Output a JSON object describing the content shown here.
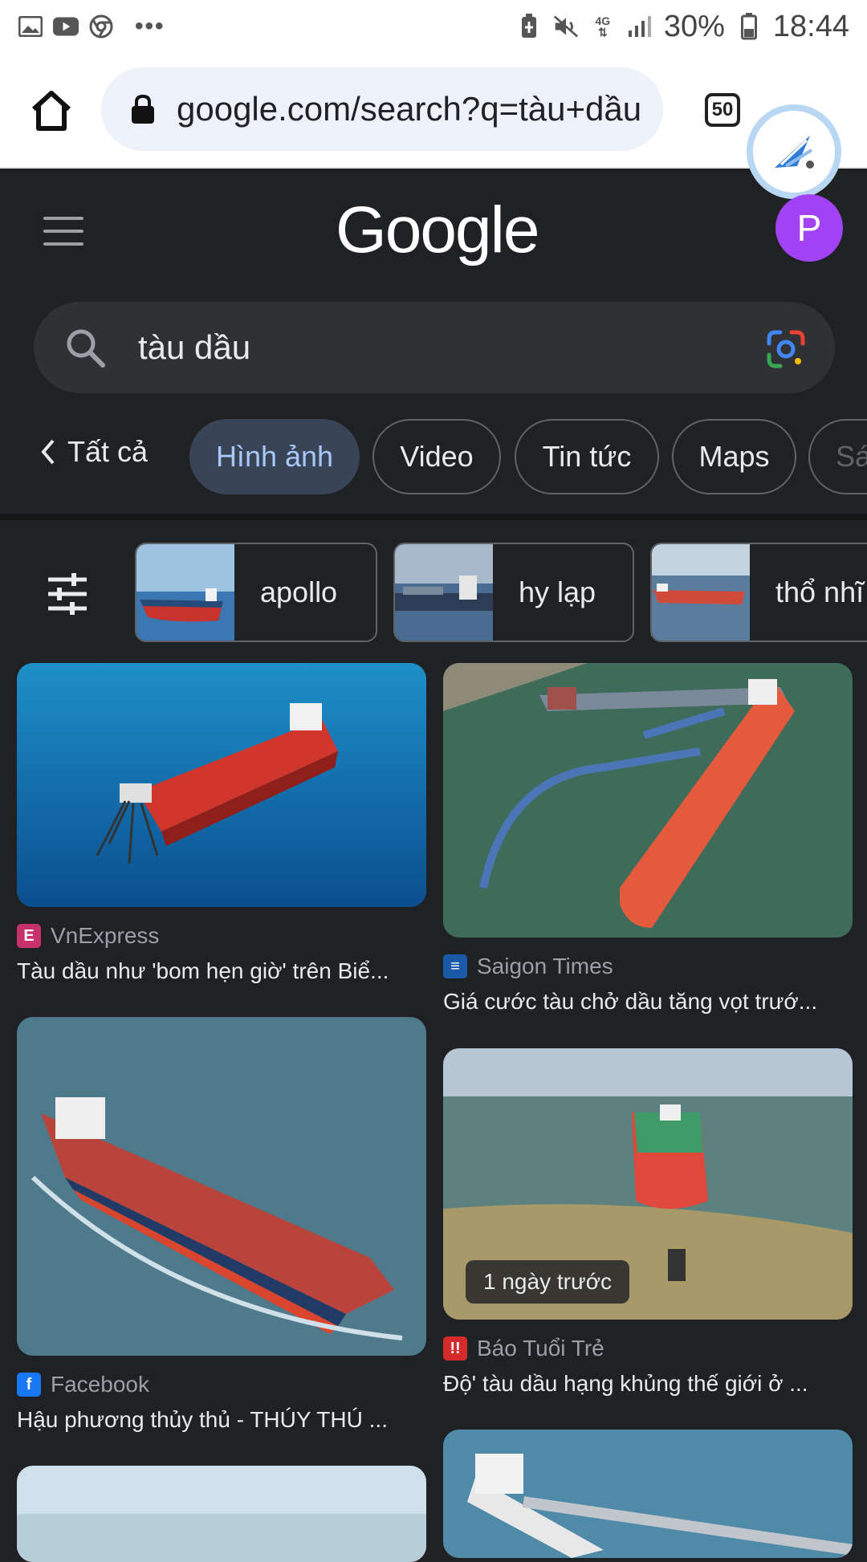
{
  "status_bar": {
    "battery": "30%",
    "time": "18:44",
    "network": "4G",
    "icons": [
      "image-icon",
      "youtube-icon",
      "chrome-icon",
      "more-dots-icon",
      "battery-saver-icon",
      "mute-icon",
      "signal-icon",
      "battery-icon"
    ]
  },
  "browser": {
    "url": "google.com/search?q=tàu+dầu",
    "tab_count": "50"
  },
  "header": {
    "logo": "Google",
    "avatar_letter": "P"
  },
  "search": {
    "query": "tàu dầu"
  },
  "tabs": {
    "back_label": "Tất cả",
    "items": [
      {
        "label": "Hình ảnh",
        "active": true
      },
      {
        "label": "Video",
        "active": false
      },
      {
        "label": "Tin tức",
        "active": false
      },
      {
        "label": "Maps",
        "active": false
      },
      {
        "label": "Sá",
        "active": false
      }
    ]
  },
  "suggestions": [
    {
      "label": "apollo"
    },
    {
      "label": "hy lạp"
    },
    {
      "label": "thổ nhĩ"
    }
  ],
  "results": [
    {
      "source": "VnExpress",
      "title": "Tàu dầu như 'bom hẹn giờ' trên Biể..."
    },
    {
      "source": "Saigon Times",
      "title": "Giá cước tàu chở dầu tăng vọt trướ..."
    },
    {
      "source": "Facebook",
      "title": "Hậu phương thủy thủ - THÚY THÚ ..."
    },
    {
      "source": "Báo Tuổi Trẻ",
      "title": "Độ' tàu dầu hạng khủng thế giới ở ...",
      "badge": "1 ngày trước"
    }
  ],
  "colors": {
    "background": "#202124",
    "chip_active_bg": "#394457",
    "chip_active_text": "#a8c7fa",
    "avatar": "#a142f4"
  }
}
